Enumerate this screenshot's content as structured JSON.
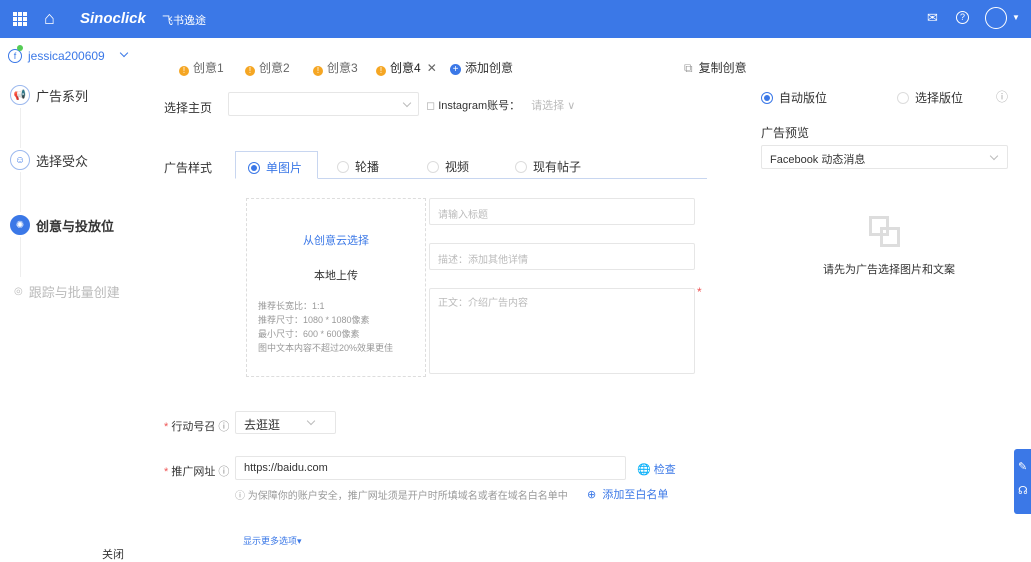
{
  "header": {
    "brand": "Sinoclick",
    "brand_cn": "飞书逸途"
  },
  "sidebar": {
    "account": "jessica200609",
    "steps": [
      {
        "label": "广告系列"
      },
      {
        "label": "选择受众"
      },
      {
        "label": "创意与投放位"
      },
      {
        "label": "跟踪与批量创建"
      }
    ],
    "close": "关闭"
  },
  "tabs": [
    {
      "label": "创意1"
    },
    {
      "label": "创意2"
    },
    {
      "label": "创意3"
    },
    {
      "label": "创意4"
    }
  ],
  "add_creative": "添加创意",
  "copy_creative": "复制创意",
  "form": {
    "page_label": "选择主页",
    "page_value": "",
    "instagram_label": "Instagram账号：",
    "instagram_placeholder": "请选择",
    "style_label": "广告样式",
    "styles": [
      "单图片",
      "轮播",
      "视频",
      "现有帖子"
    ],
    "cloud_select": "从创意云选择",
    "local_upload": "本地上传",
    "tips": [
      "推荐长宽比：1:1",
      "推荐尺寸：1080 * 1080像素",
      "最小尺寸：600 * 600像素",
      "图中文本内容不超过20%效果更佳"
    ],
    "title_placeholder": "请输入标题",
    "desc_placeholder": "描述：添加其他详情",
    "body_placeholder": "正文：介绍广告内容",
    "cta_label": "行动号召",
    "cta_value": "去逛逛",
    "url_label": "推广网址",
    "url_value": "https://baidu.com",
    "check": "检查",
    "url_note": "为保障你的账户安全，推广网址须是开户时所填域名或者在域名白名单中",
    "add_whitelist": "添加至白名单",
    "more_options": "显示更多选项"
  },
  "preview": {
    "auto": "自动版位",
    "manual": "选择版位",
    "label": "广告预览",
    "placement": "Facebook 动态消息",
    "empty": "请先为广告选择图片和文案"
  }
}
